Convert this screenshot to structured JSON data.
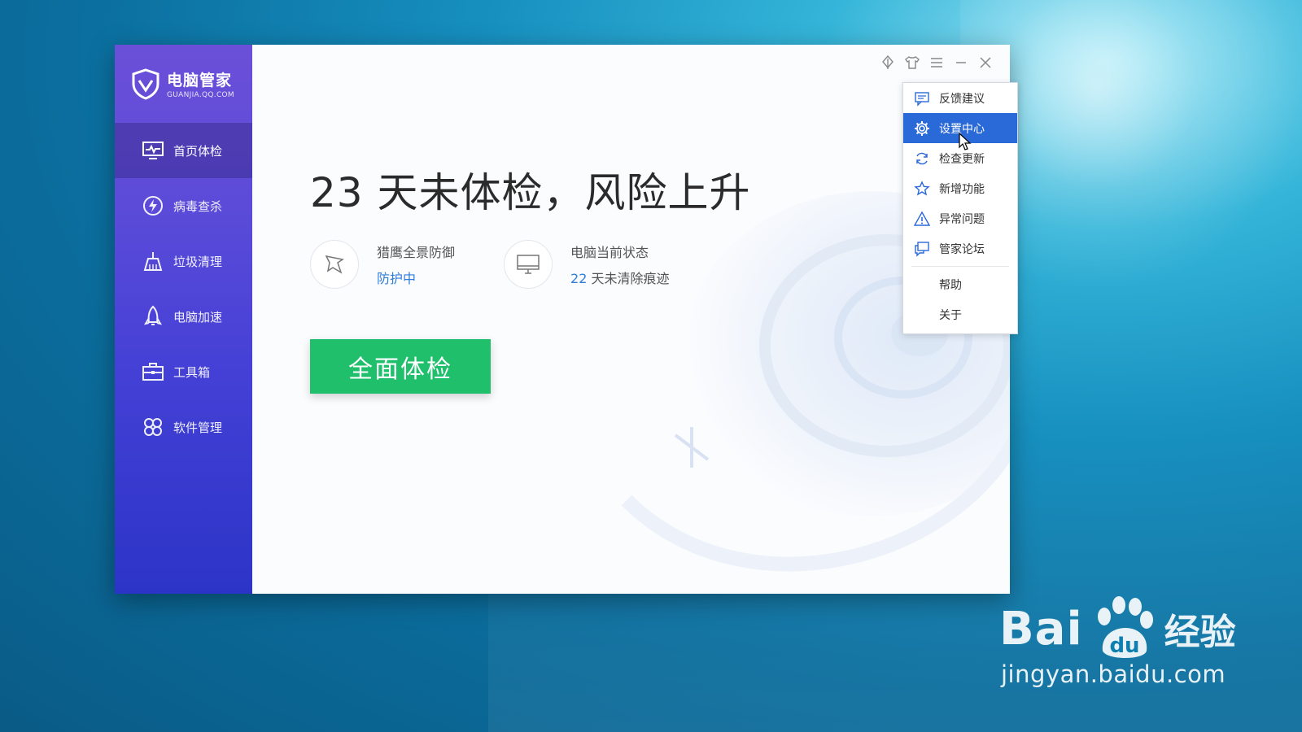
{
  "app": {
    "logo_cn": "电脑管家",
    "logo_en": "GUANJIA.QQ.COM"
  },
  "sidebar": {
    "items": [
      {
        "label": "首页体检",
        "icon": "monitor-pulse-icon",
        "active": true
      },
      {
        "label": "病毒查杀",
        "icon": "lightning-shield-icon"
      },
      {
        "label": "垃圾清理",
        "icon": "broom-icon"
      },
      {
        "label": "电脑加速",
        "icon": "rocket-icon"
      },
      {
        "label": "工具箱",
        "icon": "toolbox-icon"
      },
      {
        "label": "软件管理",
        "icon": "apps-icon"
      }
    ]
  },
  "main": {
    "headline": "23 天未体检，风险上升",
    "status": [
      {
        "label": "猎鹰全景防御",
        "value": "防护中",
        "icon": "eagle-icon"
      },
      {
        "label": "电脑当前状态",
        "value_num": "22",
        "value_text": " 天未清除痕迹",
        "icon": "desktop-icon"
      }
    ],
    "scan_button": "全面体检"
  },
  "menu": {
    "items": [
      {
        "label": "反馈建议",
        "icon": "chat-icon"
      },
      {
        "label": "设置中心",
        "icon": "gear-icon",
        "hover": true
      },
      {
        "label": "检查更新",
        "icon": "refresh-icon"
      },
      {
        "label": "新增功能",
        "icon": "star-icon"
      },
      {
        "label": "异常问题",
        "icon": "warning-icon"
      },
      {
        "label": "管家论坛",
        "icon": "forum-icon"
      }
    ],
    "extra": [
      {
        "label": "帮助"
      },
      {
        "label": "关于"
      }
    ]
  },
  "watermark": {
    "brand_left": "Bai",
    "brand_du": "du",
    "brand_cn": "经验",
    "url": "jingyan.baidu.com"
  },
  "colors": {
    "sidebar_top": "#6b4fd8",
    "sidebar_bottom": "#2c34c7",
    "scan_button": "#1fbf6c",
    "menu_highlight": "#2a6ad8",
    "status_blue": "#2f7ed8"
  }
}
